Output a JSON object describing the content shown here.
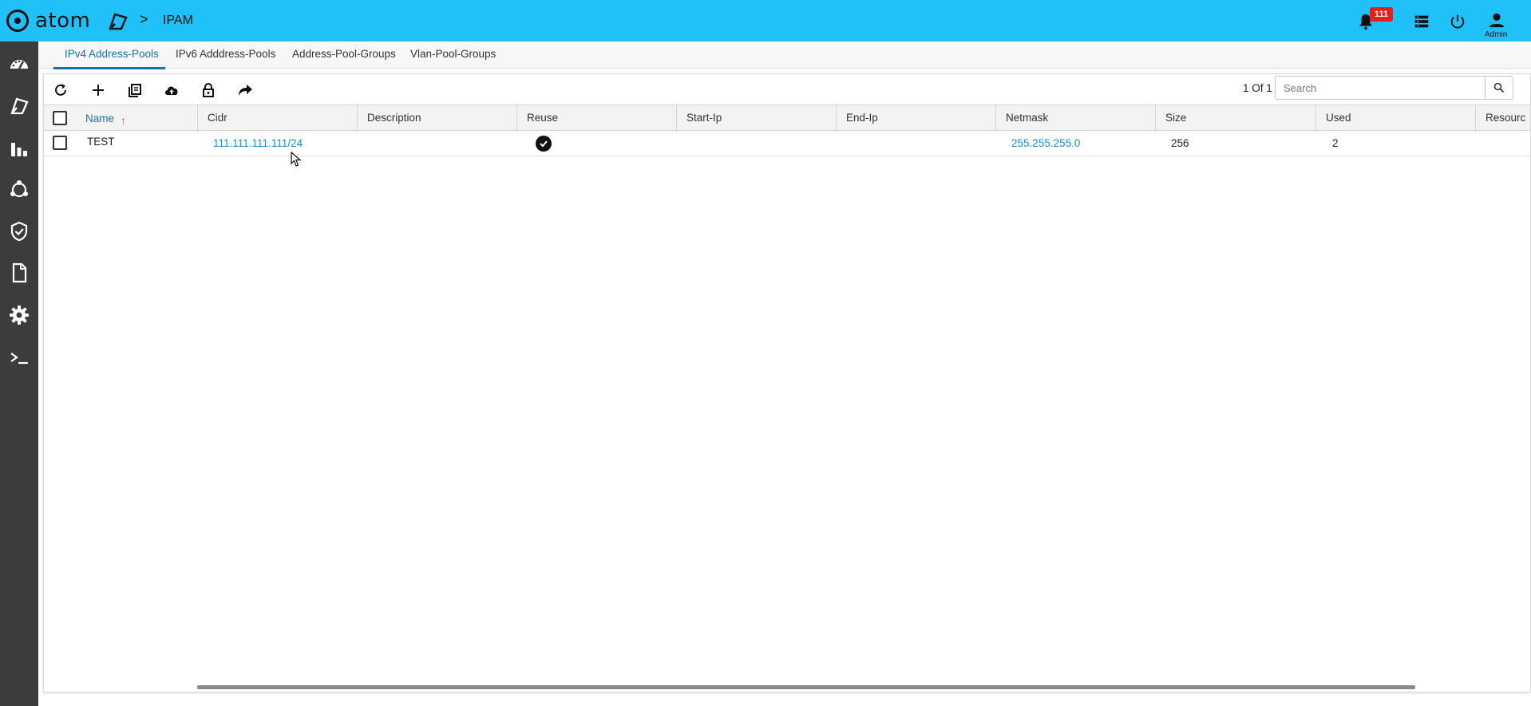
{
  "header": {
    "logo_text": "atom",
    "breadcrumb_separator": ">",
    "breadcrumb_current": "IPAM",
    "notification_count": "111",
    "user_label": "Admin",
    "icons": [
      "bell-icon",
      "list-icon",
      "power-icon",
      "user-icon"
    ]
  },
  "sidebar": {
    "items": [
      {
        "icon": "dashboard-gauge-icon"
      },
      {
        "icon": "inventory-icon"
      },
      {
        "icon": "bar-chart-icon"
      },
      {
        "icon": "topology-icon"
      },
      {
        "icon": "shield-check-icon"
      },
      {
        "icon": "document-icon"
      },
      {
        "icon": "settings-gear-icon"
      },
      {
        "icon": "terminal-icon"
      }
    ]
  },
  "tabs": [
    {
      "label": "IPv4 Address-Pools",
      "active": true
    },
    {
      "label": "IPv6 Adddress-Pools",
      "active": false
    },
    {
      "label": "Address-Pool-Groups",
      "active": false
    },
    {
      "label": "Vlan-Pool-Groups",
      "active": false
    }
  ],
  "toolbar": {
    "buttons": [
      "refresh-icon",
      "add-icon",
      "copy-icon",
      "upload-cloud-icon",
      "lock-icon",
      "share-arrow-icon"
    ],
    "pager_text": "1 Of 1",
    "search_placeholder": "Search"
  },
  "table": {
    "columns": [
      "Name",
      "Cidr",
      "Description",
      "Reuse",
      "Start-Ip",
      "End-Ip",
      "Netmask",
      "Size",
      "Used",
      "Resourc"
    ],
    "sorted_column": "Name",
    "rows": [
      {
        "name": "TEST",
        "cidr": "111.111.111.111/24",
        "description": "",
        "reuse": true,
        "start_ip": "",
        "end_ip": "",
        "netmask": "255.255.255.0",
        "size": "256",
        "used": "2",
        "resource": ""
      }
    ]
  },
  "colors": {
    "header_bg": "#1fc1f8",
    "sidebar_bg": "#3c3c3c",
    "accent": "#1575a8",
    "link": "#1d8fd1",
    "badge": "#e51f1f"
  }
}
